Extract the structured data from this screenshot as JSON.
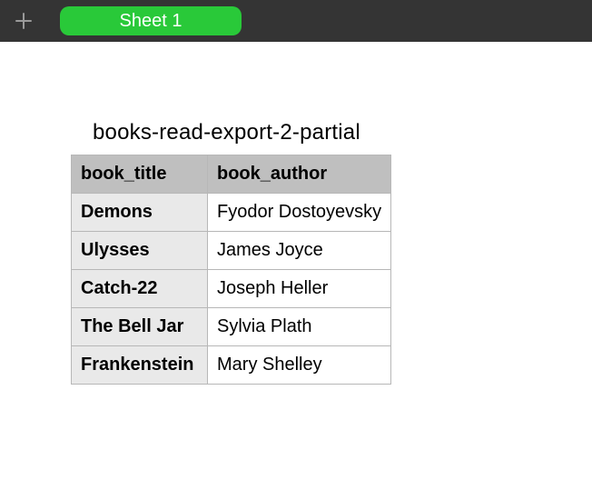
{
  "topbar": {
    "add_icon": "plus-icon",
    "tabs": [
      {
        "label": "Sheet 1",
        "active": true
      }
    ]
  },
  "table": {
    "title": "books-read-export-2-partial",
    "columns": [
      "book_title",
      "book_author"
    ],
    "rows": [
      {
        "book_title": "Demons",
        "book_author": "Fyodor Dostoyevsky"
      },
      {
        "book_title": "Ulysses",
        "book_author": "James Joyce"
      },
      {
        "book_title": "Catch-22",
        "book_author": "Joseph Heller"
      },
      {
        "book_title": "The Bell Jar",
        "book_author": "Sylvia Plath"
      },
      {
        "book_title": "Frankenstein",
        "book_author": "Mary Shelley"
      }
    ]
  }
}
